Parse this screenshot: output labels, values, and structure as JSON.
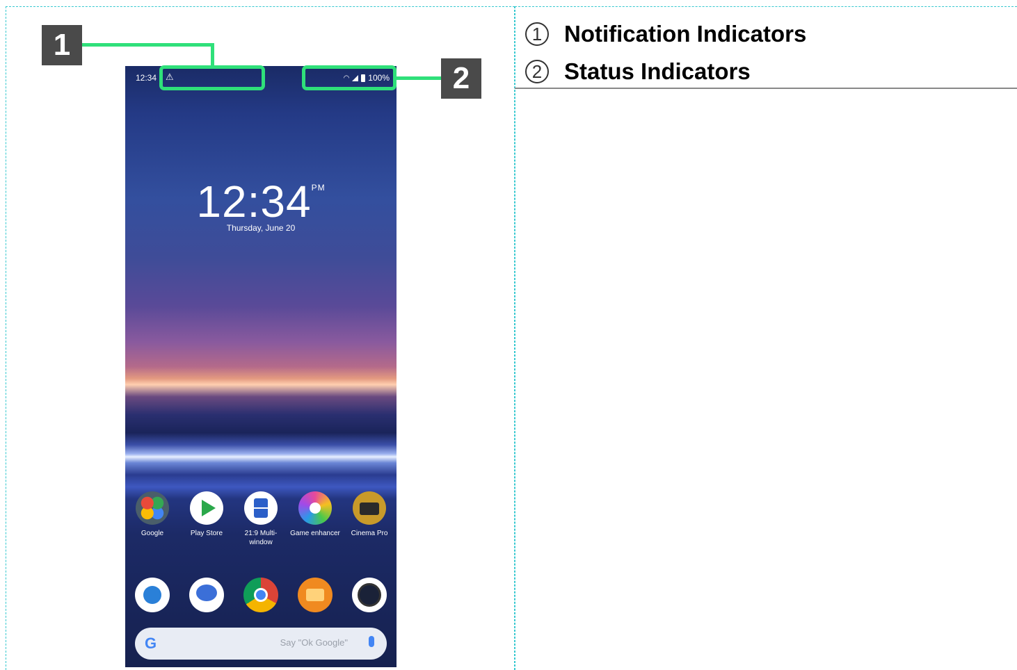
{
  "phone": {
    "status_time": "12:34",
    "status_battery": "100%",
    "clock": "12:34",
    "clock_ampm": "PM",
    "date": "Thursday, June 20",
    "apps": [
      {
        "label": "Google",
        "icon": "google-folder-icon",
        "color": "#5a7a4a"
      },
      {
        "label": "Play Store",
        "icon": "play-store-icon",
        "color": "#ffffff"
      },
      {
        "label": "21:9 Multi-window",
        "icon": "multi-window-icon",
        "color": "#2b6fd6"
      },
      {
        "label": "Game enhancer",
        "icon": "game-enhancer-icon",
        "color": "#e84a9a"
      },
      {
        "label": "Cinema Pro",
        "icon": "cinema-pro-icon",
        "color": "#c89a2a"
      }
    ],
    "dock": [
      {
        "icon": "phone-icon",
        "color": "#3a9ae8"
      },
      {
        "icon": "messages-icon",
        "color": "#3b6fd8"
      },
      {
        "icon": "chrome-icon",
        "color": "#e8b030"
      },
      {
        "icon": "album-icon",
        "color": "#f08a20"
      },
      {
        "icon": "camera-icon",
        "color": "#1a1a1a"
      }
    ],
    "search_placeholder": "Say \"Ok Google\""
  },
  "callouts": {
    "one": "1",
    "two": "2"
  },
  "legend": [
    {
      "marker": "1",
      "text": "Notification Indicators"
    },
    {
      "marker": "2",
      "text": "Status Indicators"
    }
  ],
  "colors": {
    "highlight": "#2fe07a",
    "callout_bg": "#4a4a4a",
    "frame": "#35c8cf"
  }
}
